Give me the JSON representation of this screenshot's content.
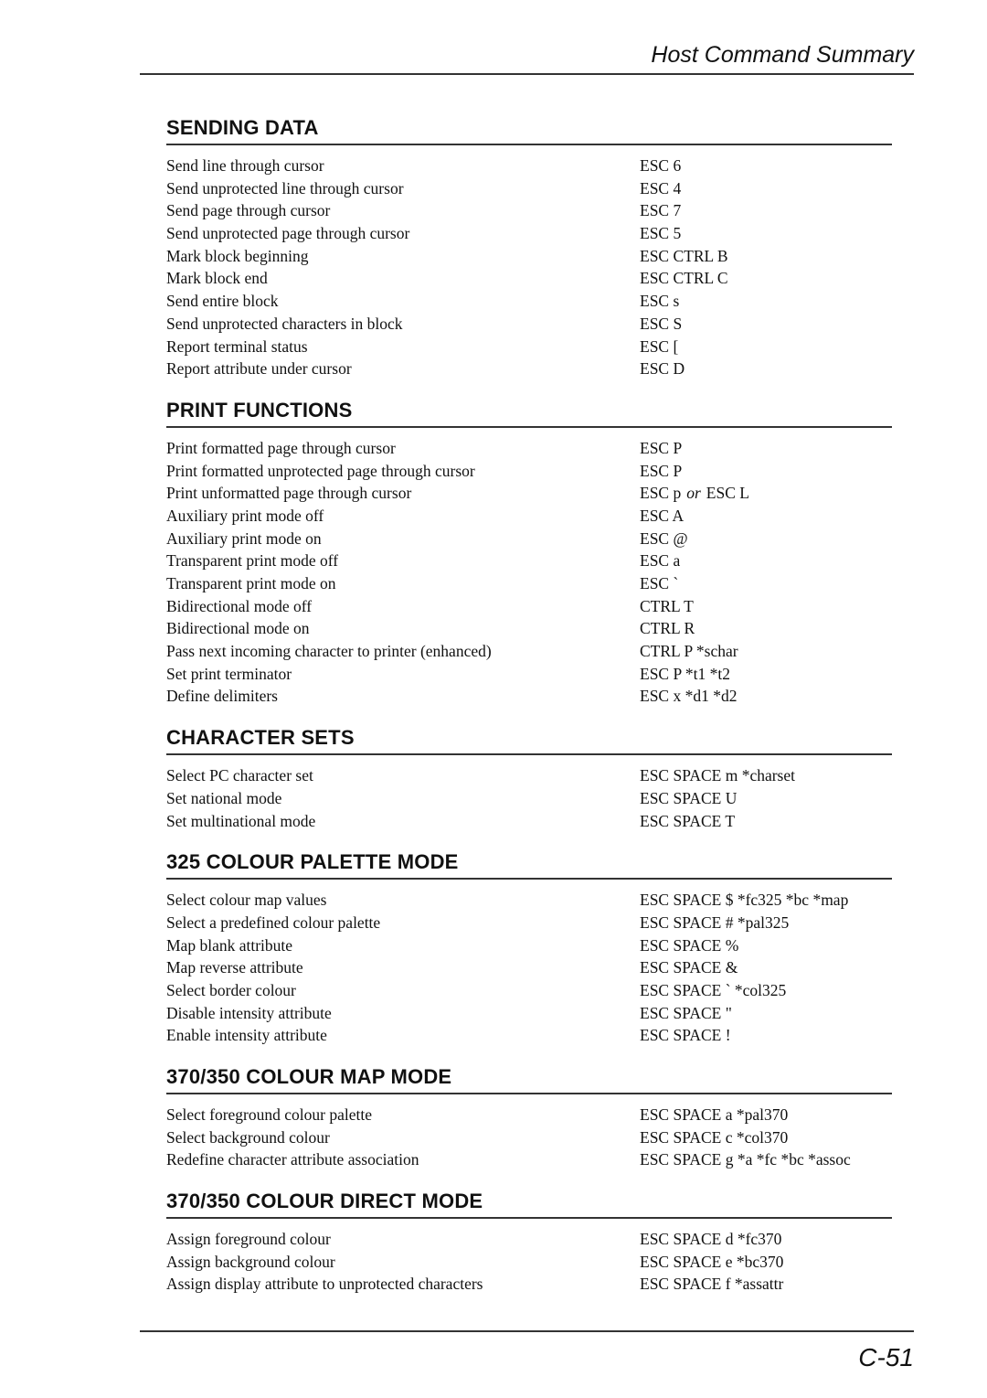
{
  "header": {
    "title": "Host Command Summary"
  },
  "sections": [
    {
      "title": "SENDING DATA",
      "rows": [
        {
          "desc": "Send line through cursor",
          "code": "ESC 6"
        },
        {
          "desc": "Send unprotected line through cursor",
          "code": "ESC 4"
        },
        {
          "desc": "Send page through cursor",
          "code": "ESC 7"
        },
        {
          "desc": "Send unprotected page through cursor",
          "code": "ESC 5"
        },
        {
          "desc": "Mark block beginning",
          "code": "ESC CTRL B"
        },
        {
          "desc": "Mark block end",
          "code": "ESC CTRL C"
        },
        {
          "desc": "Send entire block",
          "code": "ESC s"
        },
        {
          "desc": "Send unprotected characters in block",
          "code": "ESC S"
        },
        {
          "desc": "Report terminal status",
          "code": "ESC ["
        },
        {
          "desc": "Report attribute under cursor",
          "code": "ESC D"
        }
      ]
    },
    {
      "title": "PRINT FUNCTIONS",
      "rows": [
        {
          "desc": "Print formatted page through cursor",
          "code": "ESC P"
        },
        {
          "desc": "Print formatted unprotected page through cursor",
          "code": "ESC P"
        },
        {
          "desc": "Print unformatted page through cursor",
          "code": "ESC p",
          "alt_sep": "or",
          "alt_code": "ESC L"
        },
        {
          "desc": "Auxiliary print mode off",
          "code": "ESC A"
        },
        {
          "desc": "Auxiliary print mode on",
          "code": "ESC @"
        },
        {
          "desc": "Transparent print mode off",
          "code": "ESC a"
        },
        {
          "desc": "Transparent print mode on",
          "code": "ESC `"
        },
        {
          "desc": "Bidirectional mode off",
          "code": "CTRL T"
        },
        {
          "desc": "Bidirectional mode on",
          "code": "CTRL R"
        },
        {
          "desc": "Pass next incoming character to printer (enhanced)",
          "code": "CTRL P *schar"
        },
        {
          "desc": "Set print terminator",
          "code": "ESC P *t1 *t2"
        },
        {
          "desc": "Define delimiters",
          "code": "ESC x *d1 *d2"
        }
      ]
    },
    {
      "title": "CHARACTER SETS",
      "rows": [
        {
          "desc": "Select PC character set",
          "code": "ESC SPACE m *charset"
        },
        {
          "desc": "Set national mode",
          "code": "ESC SPACE U"
        },
        {
          "desc": "Set multinational mode",
          "code": "ESC SPACE T"
        }
      ]
    },
    {
      "title": "325 COLOUR PALETTE MODE",
      "rows": [
        {
          "desc": "Select colour map values",
          "code": "ESC SPACE $ *fc325 *bc *map"
        },
        {
          "desc": "Select a predefined colour palette",
          "code": "ESC SPACE # *pal325"
        },
        {
          "desc": "Map blank attribute",
          "code": "ESC SPACE %"
        },
        {
          "desc": "Map reverse attribute",
          "code": "ESC SPACE &"
        },
        {
          "desc": "Select border colour",
          "code": "ESC SPACE ` *col325"
        },
        {
          "desc": "Disable intensity attribute",
          "code": "ESC SPACE \""
        },
        {
          "desc": "Enable intensity attribute",
          "code": "ESC SPACE !"
        }
      ]
    },
    {
      "title": "370/350 COLOUR MAP MODE",
      "rows": [
        {
          "desc": "Select foreground colour palette",
          "code": "ESC SPACE a *pal370"
        },
        {
          "desc": "Select background colour",
          "code": "ESC SPACE c *col370"
        },
        {
          "desc": "Redefine character attribute association",
          "code": "ESC SPACE g *a *fc *bc *assoc"
        }
      ]
    },
    {
      "title": "370/350 COLOUR DIRECT MODE",
      "rows": [
        {
          "desc": "Assign foreground colour",
          "code": "ESC SPACE d *fc370"
        },
        {
          "desc": "Assign background colour",
          "code": "ESC SPACE e *bc370"
        },
        {
          "desc": "Assign display attribute to unprotected characters",
          "code": "ESC SPACE f *assattr"
        }
      ]
    }
  ],
  "footer": {
    "page_number": "C-51"
  }
}
